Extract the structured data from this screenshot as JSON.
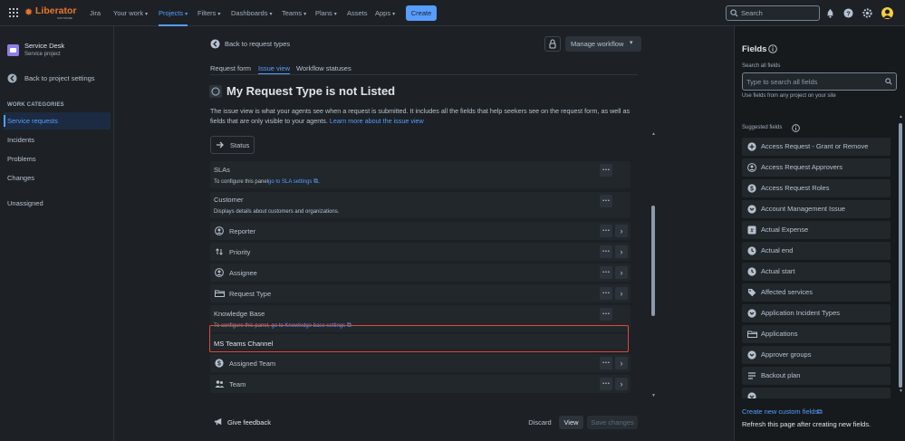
{
  "nav": {
    "logo": "Liberator",
    "logo_sub": "SOFTWARE",
    "product": "Jira",
    "items": [
      "Your work",
      "Projects",
      "Filters",
      "Dashboards",
      "Teams",
      "Plans",
      "Assets",
      "Apps"
    ],
    "create": "Create",
    "search_placeholder": "Search"
  },
  "sidebar": {
    "project_name": "Service Desk",
    "project_type": "Service project",
    "back": "Back to project settings",
    "section": "WORK CATEGORIES",
    "items": [
      "Service requests",
      "Incidents",
      "Problems",
      "Changes",
      "Unassigned"
    ]
  },
  "main": {
    "back_link": "Back to request types",
    "manage_workflow": "Manage workflow",
    "tabs": [
      "Request form",
      "Issue view",
      "Workflow statuses"
    ],
    "title": "My Request Type is not Listed",
    "description": "The issue view is what your agents see when a request is submitted. It includes all the fields that help seekers see on the request form, as well as fields that are only visible to your agents.",
    "learn_more": "Learn more about the issue view",
    "status_label": "Status",
    "slas": {
      "title": "SLAs",
      "desc": "To configure this panel",
      "link": "go to SLA settings",
      "tail": "."
    },
    "customer": {
      "title": "Customer",
      "desc": "Displays details about customers and organizations."
    },
    "rows": [
      "Reporter",
      "Priority",
      "Assignee",
      "Request Type"
    ],
    "kb": {
      "title": "Knowledge Base",
      "desc": "To configure this panel",
      "link": "go to Knowledge base settings"
    },
    "ms_teams": "MS Teams Channel",
    "rows2": [
      "Assigned Team",
      "Team"
    ],
    "give_feedback": "Give feedback",
    "discard": "Discard",
    "view": "View",
    "save": "Save changes"
  },
  "panel": {
    "title": "Fields",
    "search_label": "Search all fields",
    "search_placeholder": "Type to search all fields",
    "search_hint": "Use fields from any project on your site",
    "suggested": "Suggested fields",
    "fields": [
      {
        "label": "Access Request - Grant or Remove",
        "icon": "plus-circle-icon"
      },
      {
        "label": "Access Request Approvers",
        "icon": "user-circle-icon"
      },
      {
        "label": "Access Request Roles",
        "icon": "dollar-circle-icon"
      },
      {
        "label": "Account Management Issue",
        "icon": "chevron-circle-icon"
      },
      {
        "label": "Actual Expense",
        "icon": "number-icon"
      },
      {
        "label": "Actual end",
        "icon": "clock-icon"
      },
      {
        "label": "Actual start",
        "icon": "clock-icon"
      },
      {
        "label": "Affected services",
        "icon": "tag-icon"
      },
      {
        "label": "Application Incident Types",
        "icon": "chevron-circle-icon"
      },
      {
        "label": "Applications",
        "icon": "folder-icon"
      },
      {
        "label": "Approver groups",
        "icon": "chevron-circle-icon"
      },
      {
        "label": "Backout plan",
        "icon": "paragraph-icon"
      }
    ],
    "create_custom": "Create new custom fields",
    "refresh_hint": "Refresh this page after creating new fields."
  },
  "colors": {
    "accent": "#579dff",
    "highlight_border": "#e2483d",
    "background": "#1d2125",
    "panel_bg": "#161a1d"
  }
}
